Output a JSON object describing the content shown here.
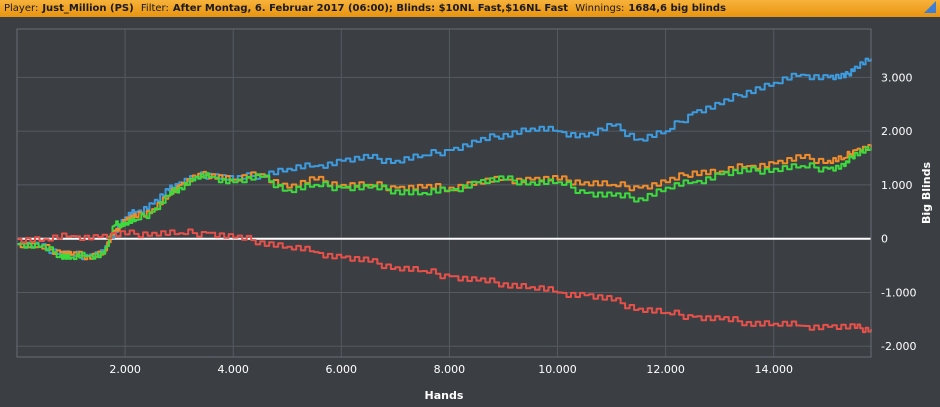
{
  "header": {
    "player_label": "Player:",
    "player_value": "Just_Million (PS)",
    "filter_label": "Filter:",
    "filter_value": "After Montag, 6. Februar 2017 (06:00); Blinds: $10NL Fast,$16NL Fast",
    "winnings_label": "Winnings:",
    "winnings_value": "1684,6 big blinds"
  },
  "chart_data": {
    "type": "line",
    "xlabel": "Hands",
    "ylabel": "Big Blinds",
    "xlim": [
      0,
      15800
    ],
    "ylim": [
      -2200,
      3900
    ],
    "x_ticks": [
      2000,
      4000,
      6000,
      8000,
      10000,
      12000,
      14000
    ],
    "x_tick_labels": [
      "2.000",
      "4.000",
      "6.000",
      "8.000",
      "10.000",
      "12.000",
      "14.000"
    ],
    "y_ticks": [
      3000,
      2000,
      1000,
      0,
      -1000,
      -2000
    ],
    "y_tick_labels": [
      "3.000",
      "2.000",
      "1.000",
      "0",
      "-1.000",
      "-2.000"
    ],
    "grid": true,
    "zero_line": true,
    "series": [
      {
        "color": "#3d9be0",
        "x": [
          0,
          400,
          800,
          1000,
          1300,
          1600,
          1800,
          2000,
          2200,
          2500,
          2800,
          3000,
          3300,
          3600,
          4000,
          4500,
          5000,
          5500,
          6000,
          6500,
          7000,
          7500,
          8000,
          8500,
          9000,
          9500,
          10000,
          10500,
          11000,
          11500,
          12000,
          12500,
          13000,
          13500,
          14000,
          14500,
          15000,
          15300,
          15500,
          15800
        ],
        "y": [
          -100,
          -150,
          -250,
          -300,
          -320,
          -250,
          150,
          400,
          500,
          650,
          900,
          1050,
          1150,
          1200,
          1100,
          1200,
          1300,
          1350,
          1450,
          1500,
          1450,
          1550,
          1650,
          1800,
          1950,
          2050,
          2000,
          1900,
          2100,
          1850,
          2000,
          2350,
          2500,
          2750,
          2900,
          3050,
          3000,
          3000,
          3200,
          3350
        ]
      },
      {
        "color": "#f08c2a",
        "x": [
          0,
          400,
          800,
          1000,
          1300,
          1600,
          1800,
          2000,
          2200,
          2500,
          2800,
          3000,
          3300,
          3600,
          4000,
          4500,
          5000,
          5500,
          6000,
          6500,
          7000,
          7500,
          8000,
          8500,
          9000,
          9500,
          10000,
          10500,
          11000,
          11500,
          12000,
          12500,
          13000,
          13500,
          14000,
          14500,
          15000,
          15300,
          15500,
          15800
        ],
        "y": [
          -100,
          -150,
          -250,
          -300,
          -320,
          -250,
          150,
          350,
          400,
          550,
          800,
          1000,
          1150,
          1200,
          1100,
          1200,
          950,
          1100,
          1000,
          1000,
          950,
          950,
          950,
          1050,
          1100,
          1100,
          1100,
          1050,
          1000,
          950,
          1050,
          1250,
          1250,
          1350,
          1400,
          1500,
          1450,
          1500,
          1650,
          1700
        ]
      },
      {
        "color": "#3dda3d",
        "x": [
          0,
          400,
          800,
          1000,
          1300,
          1600,
          1800,
          2000,
          2200,
          2500,
          2800,
          3000,
          3300,
          3600,
          4000,
          4500,
          5000,
          5500,
          6000,
          6500,
          7000,
          7500,
          8000,
          8500,
          9000,
          9500,
          10000,
          10500,
          11000,
          11500,
          12000,
          12500,
          13000,
          13500,
          14000,
          14500,
          15000,
          15300,
          15500,
          15800
        ],
        "y": [
          -100,
          -150,
          -300,
          -350,
          -320,
          -280,
          250,
          300,
          350,
          500,
          800,
          950,
          1150,
          1150,
          1050,
          1150,
          900,
          1000,
          950,
          950,
          900,
          850,
          900,
          1050,
          1100,
          1050,
          1050,
          850,
          800,
          750,
          950,
          1050,
          1200,
          1250,
          1300,
          1350,
          1300,
          1350,
          1600,
          1700
        ]
      },
      {
        "color": "#e8504a",
        "x": [
          0,
          500,
          1000,
          1500,
          2000,
          2500,
          3000,
          3500,
          4000,
          4500,
          5000,
          5500,
          6000,
          6500,
          7000,
          7500,
          8000,
          8500,
          9000,
          9500,
          10000,
          10500,
          11000,
          11500,
          12000,
          12500,
          13000,
          13500,
          14000,
          14500,
          15000,
          15500,
          15800
        ],
        "y": [
          0,
          -10,
          50,
          30,
          80,
          110,
          100,
          110,
          20,
          -50,
          -150,
          -250,
          -350,
          -430,
          -530,
          -600,
          -700,
          -780,
          -830,
          -900,
          -1000,
          -1050,
          -1150,
          -1300,
          -1380,
          -1450,
          -1500,
          -1550,
          -1580,
          -1620,
          -1640,
          -1660,
          -1680
        ]
      }
    ]
  }
}
